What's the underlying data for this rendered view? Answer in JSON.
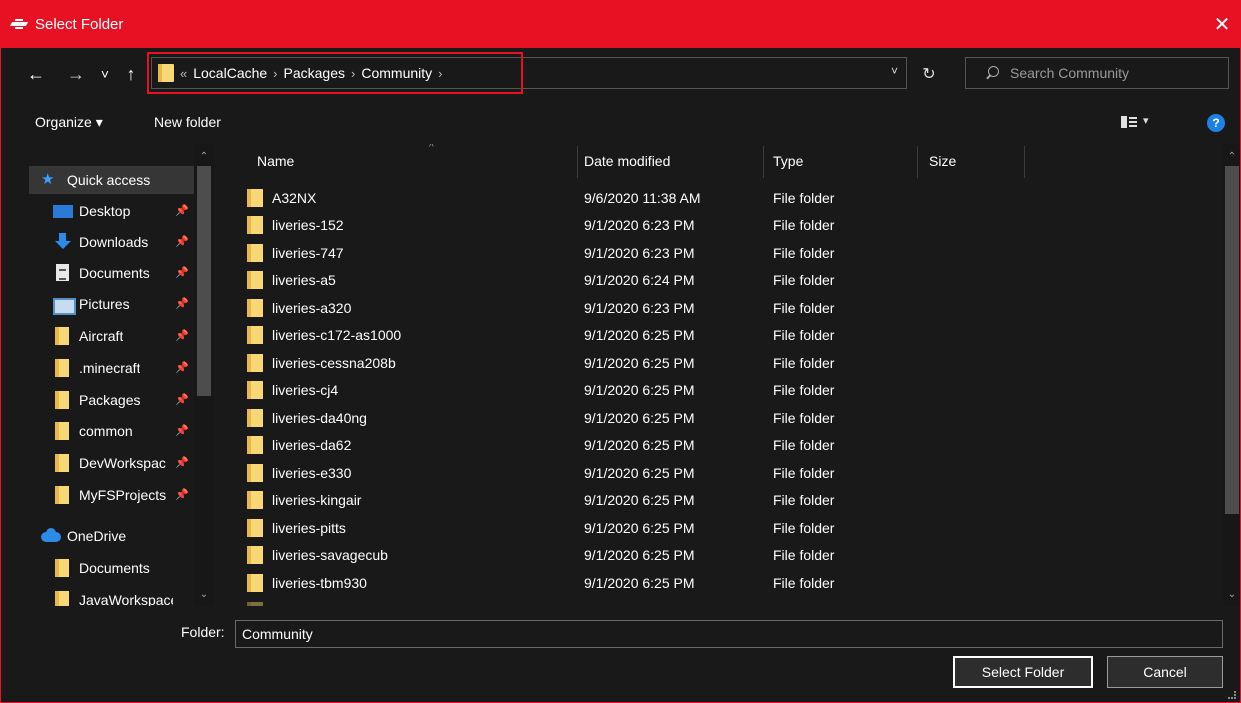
{
  "window": {
    "title": "Select Folder",
    "close_glyph": "✕",
    "accent_color": "#e81123"
  },
  "nav": {
    "back_glyph": "←",
    "forward_glyph": "→",
    "recent_glyph": "˅",
    "up_glyph": "↑",
    "overflow_glyph": "«",
    "breadcrumbs": [
      "LocalCache",
      "Packages",
      "Community"
    ],
    "separator": "›",
    "dropdown_glyph": "˅",
    "refresh_glyph": "↻",
    "search_placeholder": "Search Community"
  },
  "toolbar": {
    "organize_label": "Organize ▾",
    "new_folder_label": "New folder",
    "view_dropdown_glyph": "▾",
    "help_glyph": "?"
  },
  "sidebar": {
    "items": [
      {
        "label": "Quick access",
        "icon": "star-icon"
      },
      {
        "label": "Desktop",
        "icon": "desktop-icon",
        "pin": "📌"
      },
      {
        "label": "Downloads",
        "icon": "download-icon",
        "pin": "📌"
      },
      {
        "label": "Documents",
        "icon": "documents-icon",
        "pin": "📌"
      },
      {
        "label": "Pictures",
        "icon": "pictures-icon",
        "pin": "📌"
      },
      {
        "label": "Aircraft",
        "icon": "folder-icon",
        "pin": "📌"
      },
      {
        "label": ".minecraft",
        "icon": "folder-icon",
        "pin": "📌"
      },
      {
        "label": "Packages",
        "icon": "folder-icon",
        "pin": "📌"
      },
      {
        "label": "common",
        "icon": "folder-icon",
        "pin": "📌"
      },
      {
        "label": "DevWorkspac",
        "icon": "folder-icon",
        "pin": "📌"
      },
      {
        "label": "MyFSProjects",
        "icon": "folder-icon",
        "pin": "📌"
      },
      {
        "label": "OneDrive",
        "icon": "onedrive-icon"
      },
      {
        "label": "Documents",
        "icon": "folder-icon"
      },
      {
        "label": "JavaWorkspace",
        "icon": "folder-icon"
      }
    ]
  },
  "filelist": {
    "columns": {
      "name": "Name",
      "date": "Date modified",
      "type": "Type",
      "size": "Size"
    },
    "sort_glyph": "^",
    "rows": [
      {
        "name": "A32NX",
        "date": "9/6/2020 11:38 AM",
        "type": "File folder"
      },
      {
        "name": "liveries-152",
        "date": "9/1/2020 6:23 PM",
        "type": "File folder"
      },
      {
        "name": "liveries-747",
        "date": "9/1/2020 6:23 PM",
        "type": "File folder"
      },
      {
        "name": "liveries-a5",
        "date": "9/1/2020 6:24 PM",
        "type": "File folder"
      },
      {
        "name": "liveries-a320",
        "date": "9/1/2020 6:23 PM",
        "type": "File folder"
      },
      {
        "name": "liveries-c172-as1000",
        "date": "9/1/2020 6:25 PM",
        "type": "File folder"
      },
      {
        "name": "liveries-cessna208b",
        "date": "9/1/2020 6:25 PM",
        "type": "File folder"
      },
      {
        "name": "liveries-cj4",
        "date": "9/1/2020 6:25 PM",
        "type": "File folder"
      },
      {
        "name": "liveries-da40ng",
        "date": "9/1/2020 6:25 PM",
        "type": "File folder"
      },
      {
        "name": "liveries-da62",
        "date": "9/1/2020 6:25 PM",
        "type": "File folder"
      },
      {
        "name": "liveries-e330",
        "date": "9/1/2020 6:25 PM",
        "type": "File folder"
      },
      {
        "name": "liveries-kingair",
        "date": "9/1/2020 6:25 PM",
        "type": "File folder"
      },
      {
        "name": "liveries-pitts",
        "date": "9/1/2020 6:25 PM",
        "type": "File folder"
      },
      {
        "name": "liveries-savagecub",
        "date": "9/1/2020 6:25 PM",
        "type": "File folder"
      },
      {
        "name": "liveries-tbm930",
        "date": "9/1/2020 6:25 PM",
        "type": "File folder"
      }
    ]
  },
  "bottom": {
    "folder_label": "Folder:",
    "folder_value": "Community",
    "select_label": "Select Folder",
    "cancel_label": "Cancel"
  }
}
